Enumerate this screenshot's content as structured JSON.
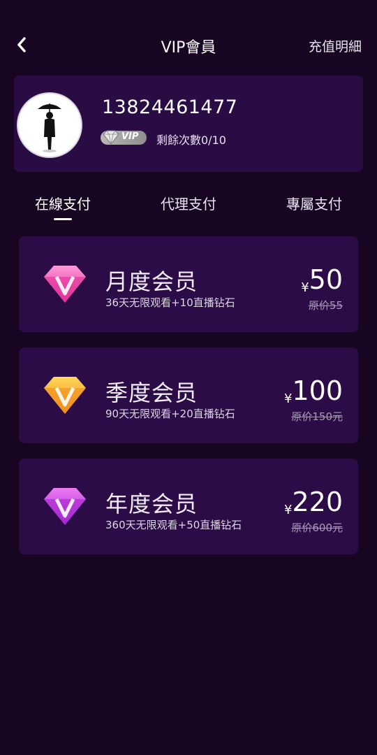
{
  "header": {
    "title": "VIP會員",
    "records_label": "充值明細"
  },
  "profile": {
    "phone": "13824461477",
    "vip_badge": "VIP",
    "remaining": "剩餘次數0/10"
  },
  "tabs": [
    {
      "label": "在線支付",
      "active": true
    },
    {
      "label": "代理支付",
      "active": false
    },
    {
      "label": "專屬支付",
      "active": false
    }
  ],
  "plans": [
    {
      "name": "月度会员",
      "desc": "36天无限观看+10直播钻石",
      "currency": "¥",
      "price": "50",
      "original": "原价55",
      "gem_color": "pink"
    },
    {
      "name": "季度会员",
      "desc": "90天无限观看+20直播钻石",
      "currency": "¥",
      "price": "100",
      "original": "原价150元",
      "gem_color": "orange"
    },
    {
      "name": "年度会员",
      "desc": "360天无限观看+50直播钻石",
      "currency": "¥",
      "price": "220",
      "original": "原价600元",
      "gem_color": "purple"
    }
  ],
  "colors": {
    "background": "#170522",
    "card": "#2b0c46",
    "gem_pink": "#f05ab8",
    "gem_orange": "#f7a51c",
    "gem_purple": "#c32bd6"
  }
}
